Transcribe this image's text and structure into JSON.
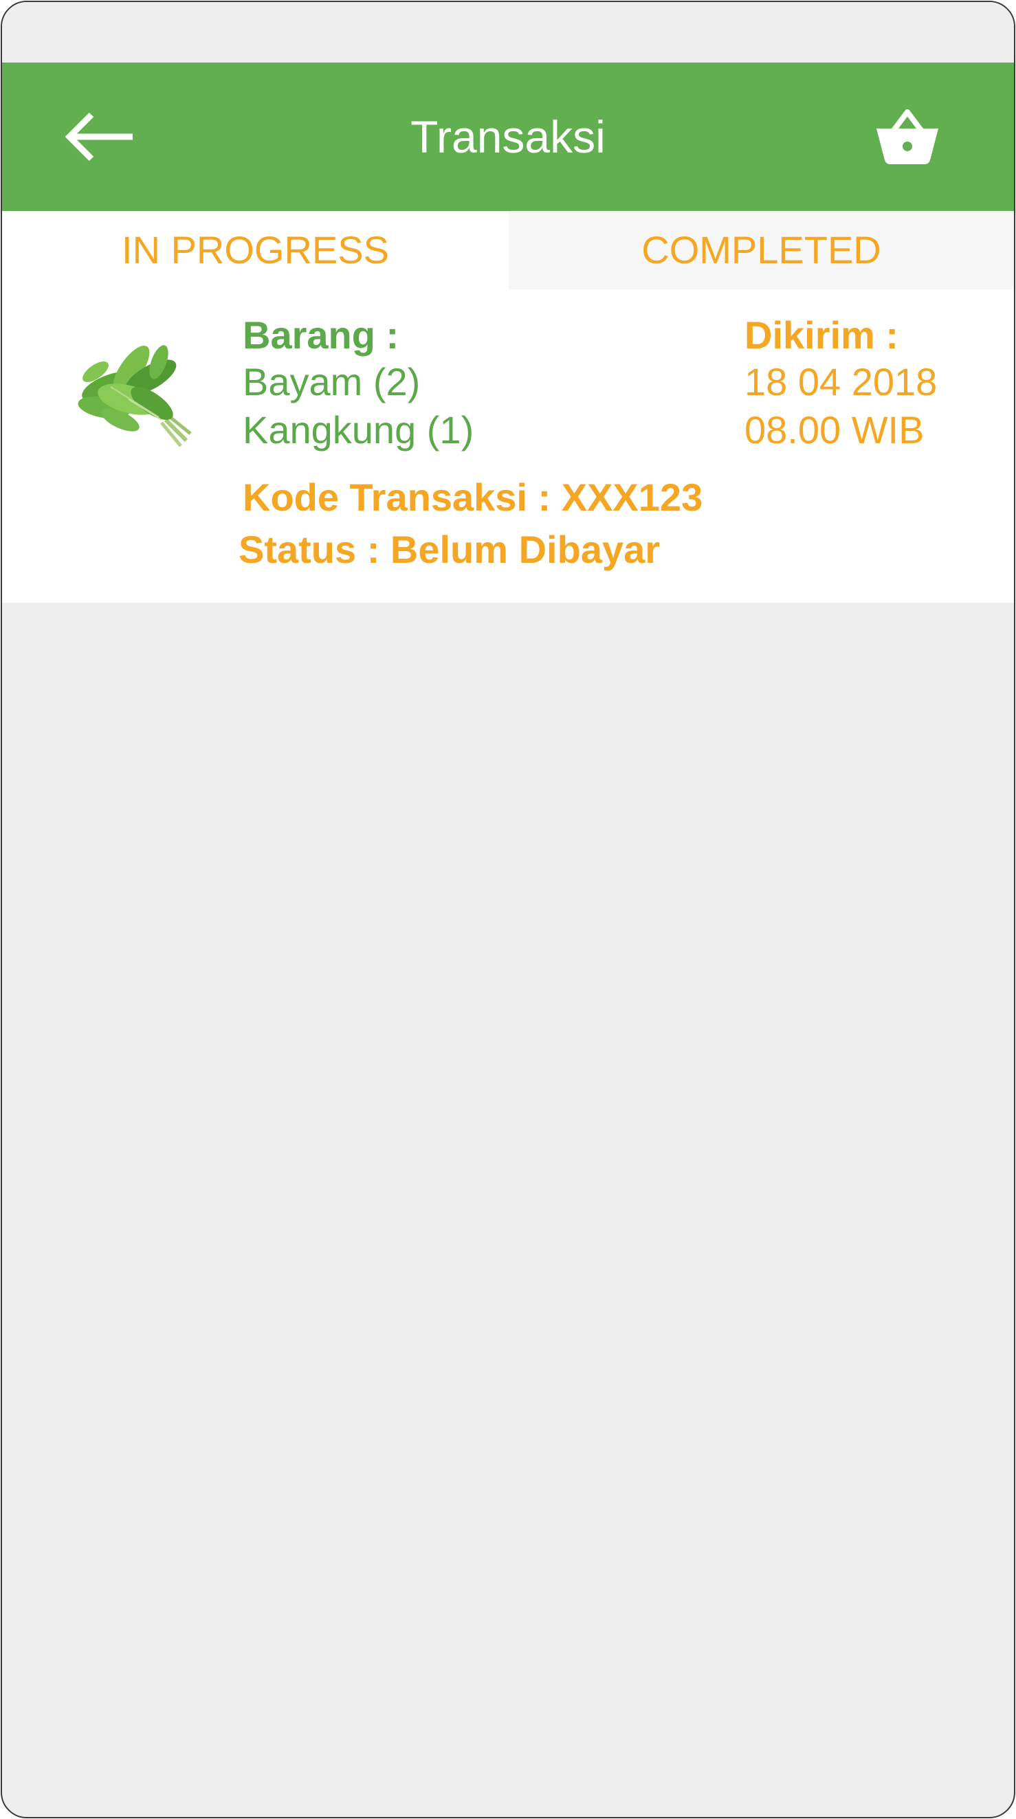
{
  "app_bar": {
    "title": "Transaksi",
    "back_icon": "arrow-left-icon",
    "cart_icon": "basket-icon"
  },
  "tabs": [
    {
      "label": "IN PROGRESS",
      "selected": true
    },
    {
      "label": "COMPLETED",
      "selected": false
    }
  ],
  "transaction": {
    "image_icon": "spinach-image",
    "items_label": "Barang :",
    "items": [
      "Bayam (2)",
      "Kangkung (1)"
    ],
    "delivery_label": "Dikirim :",
    "delivery_date": "18 04 2018",
    "delivery_time": "08.00 WIB",
    "code_text": "Kode Transaksi : XXX123",
    "status_text": "Status : Belum Dibayar"
  },
  "colors": {
    "primary_green": "#62af50",
    "text_green": "#5ba94a",
    "accent_orange": "#f5a623",
    "background": "#eeeeee"
  }
}
